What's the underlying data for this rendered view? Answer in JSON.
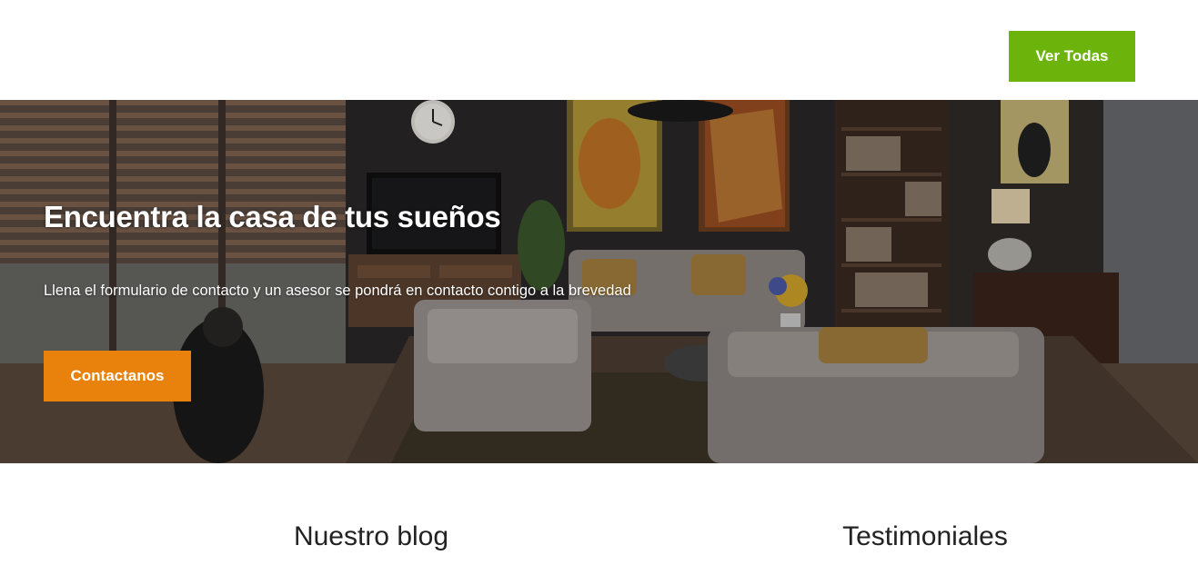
{
  "header": {
    "view_all_label": "Ver Todas",
    "view_all_color": "#6cb30c"
  },
  "hero": {
    "title": "Encuentra la casa de tus sueños",
    "subtitle": "Llena el formulario de contacto y un asesor se pondrá en contacto contigo a la brevedad",
    "cta_label": "Contactanos",
    "cta_color": "#e8820c",
    "background_image": "living-room-photo"
  },
  "sections": {
    "blog_title": "Nuestro blog",
    "testimonials_title": "Testimoniales"
  }
}
